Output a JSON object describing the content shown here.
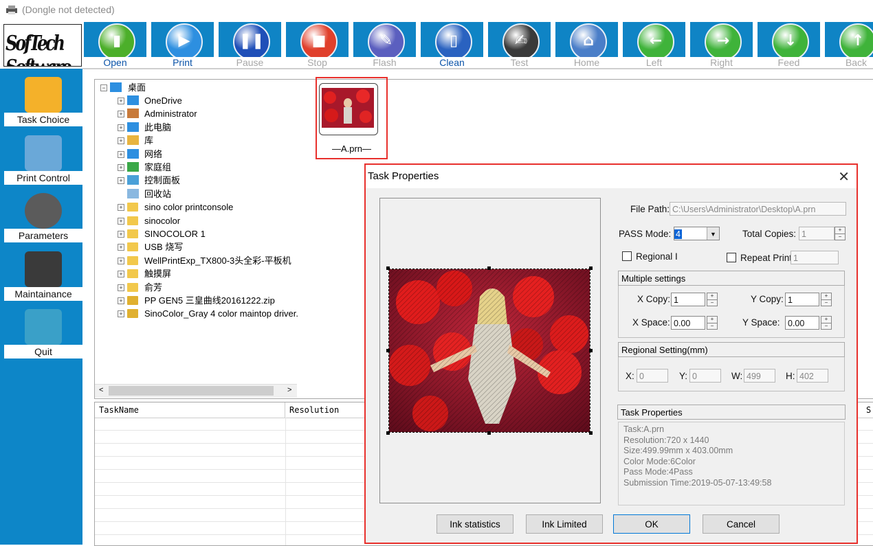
{
  "window": {
    "title": "(Dongle not detected)"
  },
  "logo": {
    "text": "SofTech Software"
  },
  "toolbar": [
    {
      "label": "Open",
      "enabled": true,
      "icon": "folder-icon",
      "color": "#4caf2a"
    },
    {
      "label": "Print",
      "enabled": true,
      "icon": "play-icon",
      "color": "#2d8fe0"
    },
    {
      "label": "Pause",
      "enabled": false,
      "icon": "pause-icon",
      "color": "#1f4fb8"
    },
    {
      "label": "Stop",
      "enabled": false,
      "icon": "stop-icon",
      "color": "#e0402c"
    },
    {
      "label": "Flash",
      "enabled": false,
      "icon": "brush-icon",
      "color": "#5b5fbf"
    },
    {
      "label": "Clean",
      "enabled": true,
      "icon": "bottle-icon",
      "color": "#2a62c0"
    },
    {
      "label": "Test",
      "enabled": false,
      "icon": "document-icon",
      "color": "#3a3a3a"
    },
    {
      "label": "Home",
      "enabled": false,
      "icon": "home-icon",
      "color": "#4a7ec8"
    },
    {
      "label": "Left",
      "enabled": false,
      "icon": "arrow-left-icon",
      "color": "#3fb33a"
    },
    {
      "label": "Right",
      "enabled": false,
      "icon": "arrow-right-icon",
      "color": "#3fb33a"
    },
    {
      "label": "Feed",
      "enabled": false,
      "icon": "arrow-down-icon",
      "color": "#3fb33a"
    },
    {
      "label": "Back",
      "enabled": false,
      "icon": "arrow-up-icon",
      "color": "#3fb33a"
    }
  ],
  "sidebar": [
    {
      "label": "Task Choice",
      "icon": "folder-icon"
    },
    {
      "label": "Print Control",
      "icon": "printer-icon"
    },
    {
      "label": "Parameters",
      "icon": "gear-icon"
    },
    {
      "label": "Maintainance",
      "icon": "tools-icon"
    },
    {
      "label": "Quit",
      "icon": "exit-icon"
    }
  ],
  "tree": {
    "root": "桌面",
    "items": [
      {
        "label": "OneDrive",
        "icon": "cloud-icon"
      },
      {
        "label": "Administrator",
        "icon": "user-icon"
      },
      {
        "label": "此电脑",
        "icon": "computer-icon"
      },
      {
        "label": "库",
        "icon": "library-icon"
      },
      {
        "label": "网络",
        "icon": "network-icon"
      },
      {
        "label": "家庭组",
        "icon": "homegroup-icon"
      },
      {
        "label": "控制面板",
        "icon": "control-panel-icon"
      },
      {
        "label": "回收站",
        "icon": "recycle-bin-icon"
      },
      {
        "label": "sino color printconsole",
        "icon": "folder-icon"
      },
      {
        "label": "sinocolor",
        "icon": "folder-icon"
      },
      {
        "label": "SINOCOLOR 1",
        "icon": "folder-icon"
      },
      {
        "label": "USB 烧写",
        "icon": "folder-icon"
      },
      {
        "label": "WellPrintExp_TX800-3头全彩-平板机",
        "icon": "folder-icon"
      },
      {
        "label": "触摸屏",
        "icon": "folder-icon"
      },
      {
        "label": "俞芳",
        "icon": "folder-icon"
      },
      {
        "label": "PP GEN5 三皇曲线20161222.zip",
        "icon": "zip-icon"
      },
      {
        "label": "SinoColor_Gray 4 color maintop driver.",
        "icon": "zip-icon"
      }
    ]
  },
  "files": [
    {
      "name": "A.prn"
    }
  ],
  "table": {
    "columns": [
      "TaskName",
      "Resolution",
      "S"
    ]
  },
  "dialog": {
    "title": "Task Properties",
    "file_path_label": "File Path:",
    "file_path": "C:\\Users\\Administrator\\Desktop\\A.prn",
    "pass_mode_label": "PASS Mode:",
    "pass_mode": "4",
    "total_copies_label": "Total Copies:",
    "total_copies": "1",
    "regional_label": "Regional I",
    "repeat_print_label": "Repeat Print",
    "repeat_print": "1",
    "multiple": {
      "title": "Multiple settings",
      "x_copy_label": "X Copy:",
      "x_copy": "1",
      "y_copy_label": "Y Copy:",
      "y_copy": "1",
      "x_space_label": "X Space:",
      "x_space": "0.00",
      "y_space_label": "Y Space:",
      "y_space": "0.00"
    },
    "regional": {
      "title": "Regional Setting(mm)",
      "x_label": "X:",
      "x": "0",
      "y_label": "Y:",
      "y": "0",
      "w_label": "W:",
      "w": "499",
      "h_label": "H:",
      "h": "402"
    },
    "props": {
      "title": "Task Properties",
      "lines": [
        "Task:A.prn",
        "Resolution:720 x 1440",
        "Size:499.99mm x 403.00mm",
        "Color Mode:6Color",
        "Pass Mode:4Pass",
        "Submission Time:2019-05-07-13:49:58"
      ]
    },
    "buttons": {
      "ink_statistics": "Ink statistics",
      "ink_limited": "Ink Limited",
      "ok": "OK",
      "cancel": "Cancel"
    }
  }
}
